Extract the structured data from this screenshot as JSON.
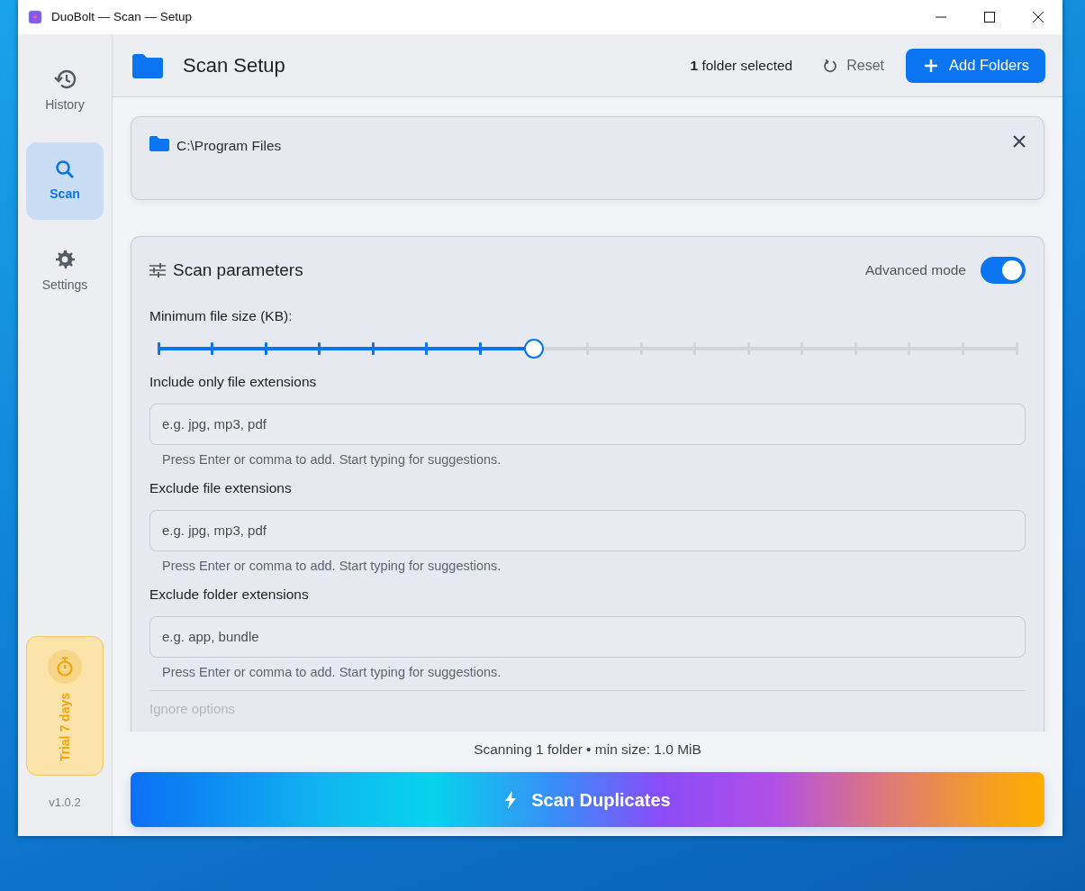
{
  "window": {
    "title": "DuoBolt — Scan — Setup"
  },
  "sidebar": {
    "items": [
      {
        "label": "History",
        "selected": false
      },
      {
        "label": "Scan",
        "selected": true
      },
      {
        "label": "Settings",
        "selected": false
      }
    ],
    "trial": "Trial 7 days",
    "version": "v1.0.2"
  },
  "header": {
    "title": "Scan Setup",
    "selection_count": "**1** folder selected",
    "reset": "Reset",
    "add": "Add Folders"
  },
  "folders": [
    {
      "path": "C:\\Program Files"
    }
  ],
  "parameters": {
    "title": "Scan parameters",
    "advanced_mode": {
      "label": "Advanced mode",
      "on": true
    },
    "min_size": {
      "label": "Minimum file size (KB):",
      "level": 0.4375
    },
    "filters": [
      {
        "label": "Include only file extensions",
        "placeholder": "e.g. jpg, mp3, pdf",
        "hint": "Press Enter or comma to add. Start typing for suggestions."
      },
      {
        "label": "Exclude file extensions",
        "placeholder": "e.g. jpg, mp3, pdf",
        "hint": "Press Enter or comma to add. Start typing for suggestions."
      },
      {
        "label": "Exclude folder extensions",
        "placeholder": "e.g. app, bundle",
        "hint": "Press Enter or comma to add. Start typing for suggestions."
      }
    ],
    "ignore_label": "Ignore options"
  },
  "status": "Scanning 1 folder • min size: 1.0 MiB",
  "scan_button": "Scan Duplicates"
}
